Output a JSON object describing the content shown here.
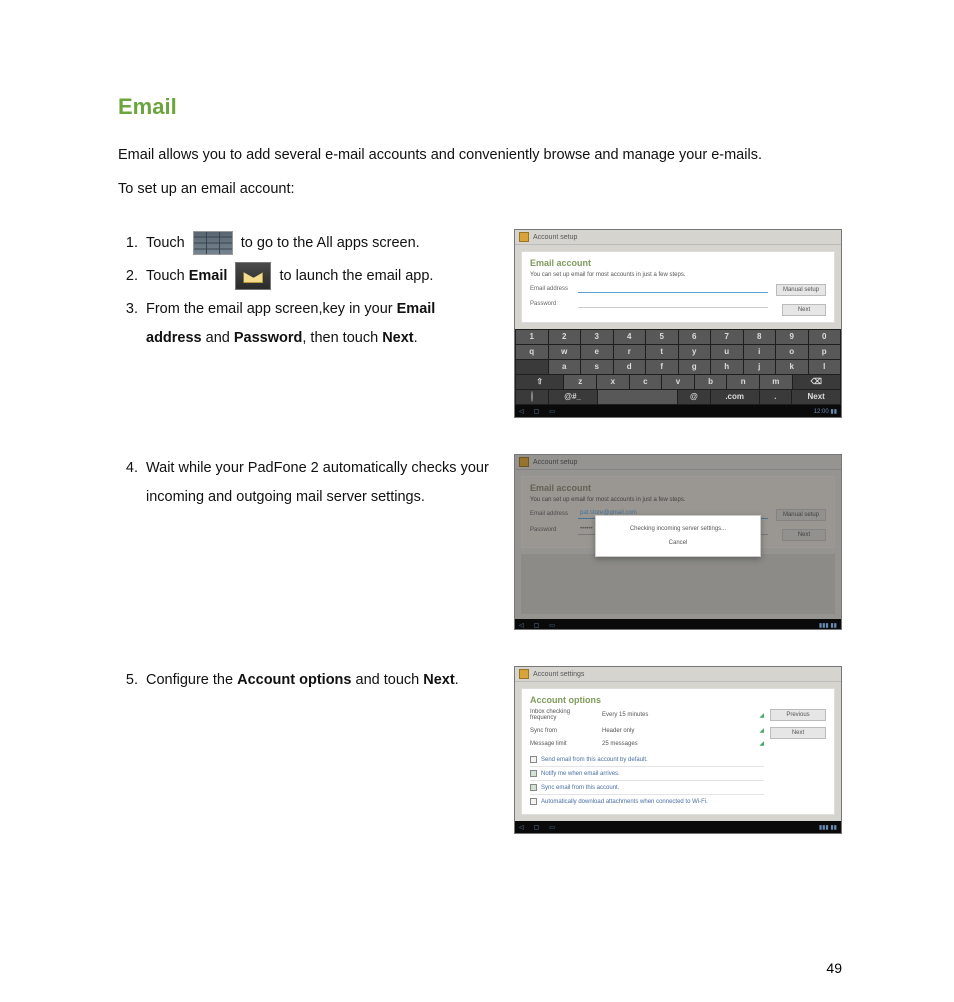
{
  "page_number": "49",
  "heading": "Email",
  "intro": "Email allows you to add several e-mail accounts and conveniently browse and manage your e-mails.",
  "setup_line": "To set up an email account:",
  "steps": {
    "s1_a": "Touch ",
    "s1_b": " to go to the All apps screen.",
    "s2_a": "Touch ",
    "s2_b": "Email",
    "s2_c": " to launch the email app.",
    "s3_a": "From the email app screen,key in your ",
    "s3_b": "Email address",
    "s3_c": " and ",
    "s3_d": "Password",
    "s3_e": ", then  touch ",
    "s3_f": "Next",
    "s3_g": ".",
    "s4": "Wait while your PadFone 2 automatically checks your incoming and outgoing mail server settings.",
    "s5_a": "Configure the ",
    "s5_b": "Account options",
    "s5_c": " and touch ",
    "s5_d": "Next",
    "s5_e": "."
  },
  "shot1": {
    "window": "Account setup",
    "heading": "Email account",
    "sub": "You can set up email for most accounts in just a few steps.",
    "label_email": "Email address",
    "label_pwd": "Password",
    "btn_manual": "Manual setup",
    "btn_next": "Next",
    "kb_row1": [
      "1",
      "2",
      "3",
      "4",
      "5",
      "6",
      "7",
      "8",
      "9",
      "0"
    ],
    "kb_row2": [
      "q",
      "w",
      "e",
      "r",
      "t",
      "y",
      "u",
      "i",
      "o",
      "p"
    ],
    "kb_row3": [
      "a",
      "s",
      "d",
      "f",
      "g",
      "h",
      "j",
      "k",
      "l"
    ],
    "kb_row4_first": "⇧",
    "kb_row4": [
      "z",
      "x",
      "c",
      "v",
      "b",
      "n",
      "m"
    ],
    "kb_row4_last": "⌫",
    "kb_row5": {
      "sym": "@#_",
      "space": "",
      "com": ".com",
      "dot": ".",
      "next": "Next"
    },
    "clock": "12:00"
  },
  "shot2": {
    "window": "Account setup",
    "heading": "Email account",
    "sub": "You can set up email for most accounts in just a few steps.",
    "label_email": "Email address",
    "email_value": "pat.store@gmail.com",
    "label_pwd": "Password",
    "pwd_value": "••••••",
    "btn_manual": "Manual setup",
    "btn_next": "Next",
    "modal_text": "Checking incoming server settings...",
    "modal_cancel": "Cancel"
  },
  "shot3": {
    "window": "Account settings",
    "heading": "Account options",
    "opt_freq_label": "Inbox checking frequency",
    "opt_freq_val": "Every 15 minutes",
    "opt_sync_label": "Sync from",
    "opt_sync_val": "Header only",
    "opt_msg_label": "Message limit",
    "opt_msg_val": "25 messages",
    "chk1": "Send email from this account by default.",
    "chk2": "Notify me when email arrives.",
    "chk3": "Sync email from this account.",
    "chk4": "Automatically download attachments when connected to Wi-Fi.",
    "btn_prev": "Previous",
    "btn_next": "Next"
  }
}
